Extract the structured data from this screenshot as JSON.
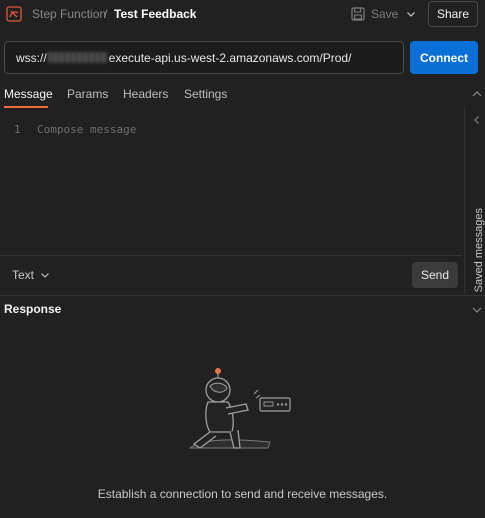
{
  "header": {
    "app_icon": "request-swirl-icon",
    "breadcrumb_parent": "Step Function",
    "breadcrumb_separator": "/",
    "title": "Test Feedback",
    "save_label": "Save",
    "share_label": "Share"
  },
  "request": {
    "url_prefix": "wss://",
    "url_suffix": "execute-api.us-west-2.amazonaws.com/Prod/",
    "connect_label": "Connect"
  },
  "tabs": [
    {
      "label": "Message",
      "active": true
    },
    {
      "label": "Params",
      "active": false
    },
    {
      "label": "Headers",
      "active": false
    },
    {
      "label": "Settings",
      "active": false
    }
  ],
  "editor": {
    "line_number": "1",
    "placeholder": "Compose message",
    "format": "Text",
    "send_label": "Send"
  },
  "sidebar": {
    "label": "Saved messages"
  },
  "response": {
    "title": "Response",
    "empty_message": "Establish a connection to send and receive messages."
  },
  "colors": {
    "background": "#212121",
    "accent_tab": "#f26b3a",
    "primary_button": "#0a6fd6"
  }
}
